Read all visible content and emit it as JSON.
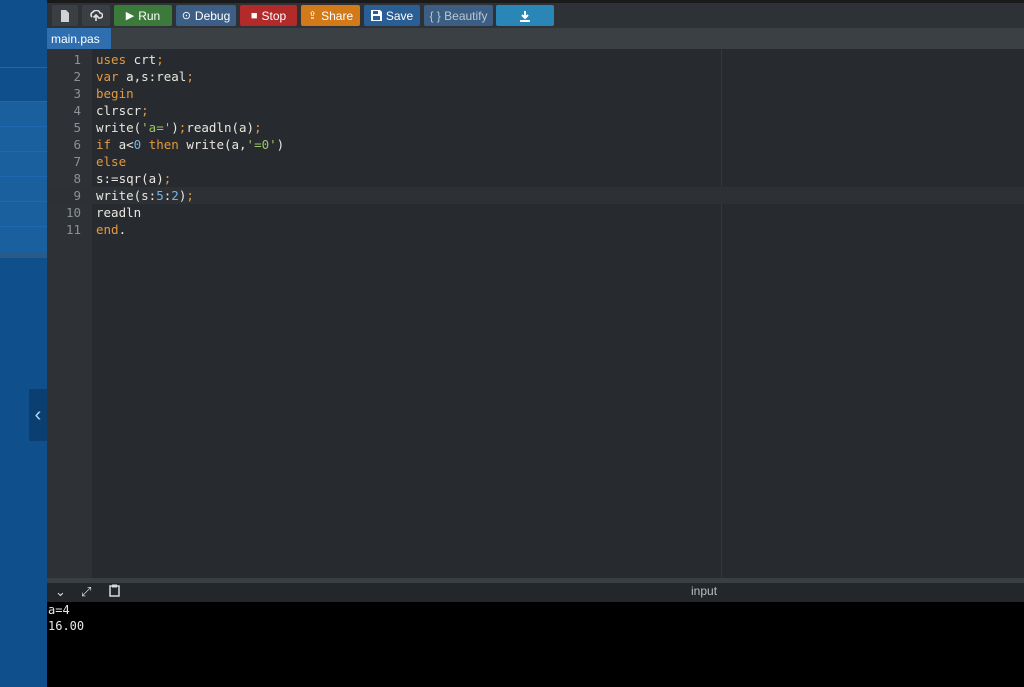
{
  "toolbar": {
    "buttons": [
      {
        "id": "new-file",
        "label": "",
        "icon": "file-icon",
        "color": "#3a3f44"
      },
      {
        "id": "upload",
        "label": "",
        "icon": "upload-icon",
        "color": "#3a3f44"
      },
      {
        "id": "run",
        "label": "Run",
        "icon": "play-icon",
        "color": "#3b7a3b"
      },
      {
        "id": "debug",
        "label": "Debug",
        "icon": "debug-icon",
        "color": "#3d5f85"
      },
      {
        "id": "stop",
        "label": "Stop",
        "icon": "stop-icon",
        "color": "#b22a2a"
      },
      {
        "id": "share",
        "label": "Share",
        "icon": "share-icon",
        "color": "#d2791a"
      },
      {
        "id": "save",
        "label": "Save",
        "icon": "save-icon",
        "color": "#2a5f95"
      },
      {
        "id": "beautify",
        "label": "{ } Beautify",
        "icon": "",
        "color": "#3c5e82"
      },
      {
        "id": "download",
        "label": "",
        "icon": "download-icon",
        "color": "#2b86b8"
      }
    ]
  },
  "tabs": [
    {
      "label": "main.pas"
    }
  ],
  "editor": {
    "active_line": 9,
    "lines": [
      [
        {
          "t": "uses",
          "c": "kw"
        },
        {
          "t": " crt",
          "c": ""
        },
        {
          "t": ";",
          "c": "pun"
        }
      ],
      [
        {
          "t": "var",
          "c": "kw"
        },
        {
          "t": " a,s:real",
          "c": ""
        },
        {
          "t": ";",
          "c": "pun"
        }
      ],
      [
        {
          "t": "begin",
          "c": "kw"
        }
      ],
      [
        {
          "t": "clrscr",
          "c": ""
        },
        {
          "t": ";",
          "c": "pun"
        }
      ],
      [
        {
          "t": "write(",
          "c": ""
        },
        {
          "t": "'a='",
          "c": "str"
        },
        {
          "t": ")",
          "c": ""
        },
        {
          "t": ";",
          "c": "pun"
        },
        {
          "t": "readln(a)",
          "c": ""
        },
        {
          "t": ";",
          "c": "pun"
        }
      ],
      [
        {
          "t": "if",
          "c": "kw"
        },
        {
          "t": " a<",
          "c": ""
        },
        {
          "t": "0",
          "c": "num"
        },
        {
          "t": " ",
          "c": ""
        },
        {
          "t": "then",
          "c": "kw"
        },
        {
          "t": " write(a,",
          "c": ""
        },
        {
          "t": "'=0'",
          "c": "str"
        },
        {
          "t": ")",
          "c": ""
        }
      ],
      [
        {
          "t": "else",
          "c": "kw"
        }
      ],
      [
        {
          "t": "s:=sqr(a)",
          "c": ""
        },
        {
          "t": ";",
          "c": "pun"
        }
      ],
      [
        {
          "t": "write(s:",
          "c": ""
        },
        {
          "t": "5",
          "c": "num"
        },
        {
          "t": ":",
          "c": ""
        },
        {
          "t": "2",
          "c": "num"
        },
        {
          "t": ")",
          "c": ""
        },
        {
          "t": ";",
          "c": "pun"
        }
      ],
      [
        {
          "t": "readln",
          "c": ""
        }
      ],
      [
        {
          "t": "end",
          "c": "kw"
        },
        {
          "t": ".",
          "c": ""
        }
      ]
    ]
  },
  "io": {
    "label": "input",
    "icons": [
      "chevron-down-icon",
      "expand-icon",
      "clipboard-icon"
    ],
    "output": [
      "a=4",
      "16.00"
    ]
  },
  "sidebar": {
    "toggle_icon": "chevron-left-icon"
  }
}
